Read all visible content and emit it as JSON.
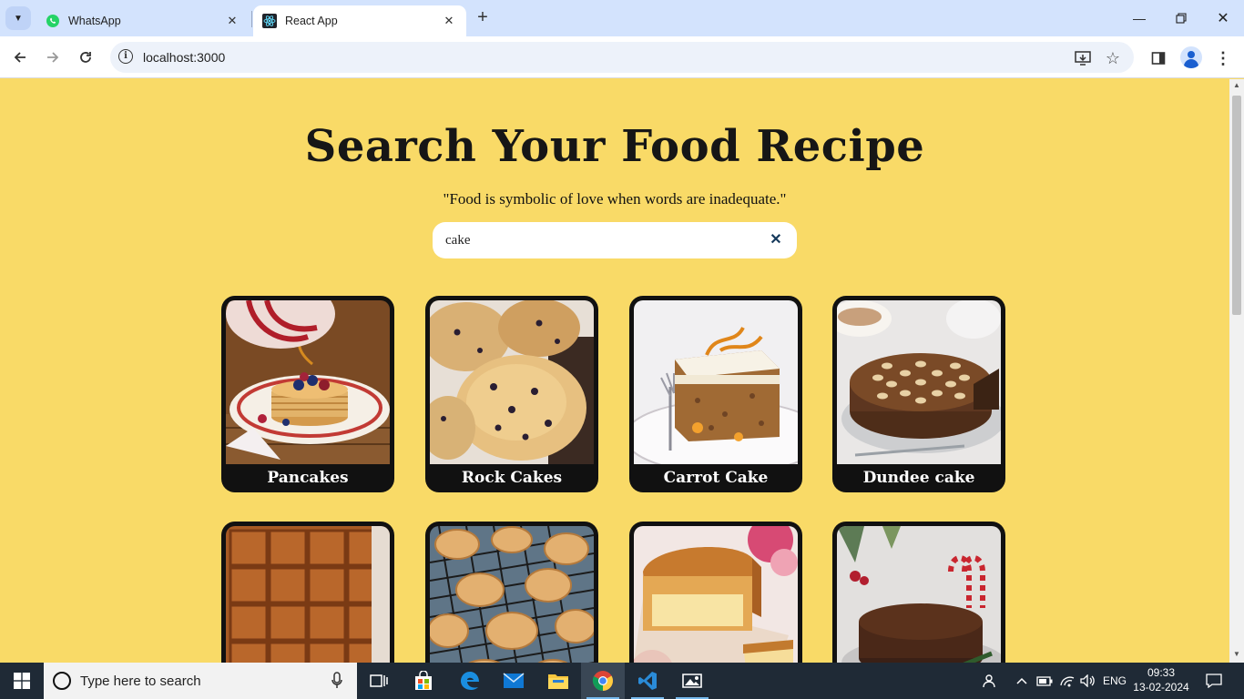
{
  "browser": {
    "tabs": [
      {
        "title": "WhatsApp",
        "active": false,
        "favicon": "whatsapp-icon"
      },
      {
        "title": "React App",
        "active": true,
        "favicon": "react-icon"
      }
    ],
    "url": "localhost:3000"
  },
  "page": {
    "heading": "Search Your Food Recipe",
    "quote": "\"Food is symbolic of love when words are inadequate.\"",
    "search": {
      "value": "cake",
      "clear_icon": "close-icon"
    },
    "recipes": [
      {
        "name": "Pancakes"
      },
      {
        "name": "Rock Cakes"
      },
      {
        "name": "Carrot Cake"
      },
      {
        "name": "Dundee cake"
      },
      {
        "name": ""
      },
      {
        "name": ""
      },
      {
        "name": ""
      },
      {
        "name": ""
      }
    ]
  },
  "taskbar": {
    "search_placeholder": "Type here to search",
    "language": "ENG",
    "time": "09:33",
    "date": "13-02-2024"
  },
  "colors": {
    "page_background": "#f9da67",
    "card_background": "#111111",
    "tabstrip": "#d3e3fd"
  }
}
